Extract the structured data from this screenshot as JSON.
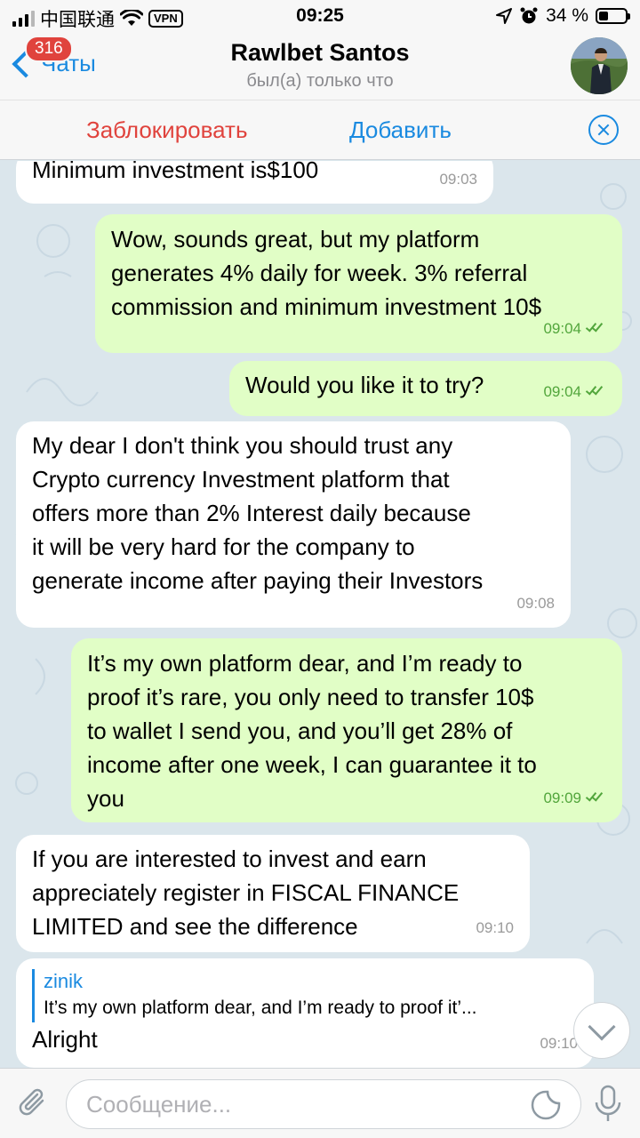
{
  "status_bar": {
    "carrier": "中国联通",
    "vpn": "VPN",
    "time": "09:25",
    "battery": "34 %",
    "battery_level": 0.34
  },
  "header": {
    "back_label": "Чаты",
    "unread_count": "316",
    "contact_name": "Rawlbet Santos",
    "status": "был(а) только что",
    "avatar_icon": "profile-photo"
  },
  "action_bar": {
    "block_label": "Заблокировать",
    "add_label": "Добавить",
    "close_icon": "close-circle-icon"
  },
  "messages": [
    {
      "direction": "in",
      "text": "Minimum investment is$100",
      "time": "09:03"
    },
    {
      "direction": "out",
      "text": "Wow, sounds great, but my platform\ngenerates 4% daily for week. 3% referral\ncommission and minimum investment 10$",
      "time": "09:04",
      "read": true
    },
    {
      "direction": "out",
      "text": "Would you like it to try?",
      "time": "09:04",
      "read": true
    },
    {
      "direction": "in",
      "text": "My dear I don't think you should trust any\nCrypto currency Investment platform that\noffers more than 2% Interest daily because\nit will be very hard for the company to\ngenerate income after paying their Investors",
      "time": "09:08"
    },
    {
      "direction": "out",
      "text": "It’s my own platform dear, and I’m ready to\nproof it’s rare, you only need to transfer 10$\nto wallet I send you, and you’ll get 28% of\nincome after one week, I can guarantee it to\nyou",
      "time": "09:09",
      "read": true
    },
    {
      "direction": "in",
      "text": "If you are interested to invest and earn\nappreciately register in FISCAL FINANCE\nLIMITED and see the difference",
      "time": "09:10"
    },
    {
      "direction": "in",
      "reply_name": "zinik",
      "reply_text": "It’s my own platform dear, and I’m ready to proof it’...",
      "text": "Alright",
      "time": "09:10"
    }
  ],
  "input_bar": {
    "placeholder": "Сообщение...",
    "value": ""
  },
  "colors": {
    "accent": "#1a8ae0",
    "danger": "#e0433d",
    "outgoing_bubble": "#e1fec6",
    "incoming_bubble": "#ffffff",
    "chat_background": "#dbe6ec"
  }
}
